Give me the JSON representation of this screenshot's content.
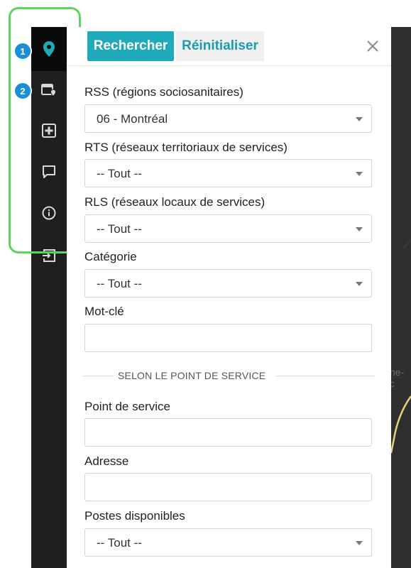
{
  "header": {
    "search_label": "Rechercher",
    "reset_label": "Réinitialiser",
    "close_icon": "close-icon"
  },
  "sidebar": {
    "items": [
      {
        "icon": "map-pin-icon",
        "badge": "1"
      },
      {
        "icon": "calendar-location-icon",
        "badge": "2"
      },
      {
        "icon": "plus-square-icon"
      },
      {
        "icon": "chat-bubble-icon"
      },
      {
        "icon": "info-circle-icon"
      },
      {
        "icon": "logout-icon"
      }
    ]
  },
  "form": {
    "rss": {
      "label": "RSS (régions sociosanitaires)",
      "value": "06 - Montréal"
    },
    "rts": {
      "label": "RTS (réseaux territoriaux de services)",
      "value": "-- Tout --"
    },
    "rls": {
      "label": "RLS (réseaux locaux de services)",
      "value": "-- Tout --"
    },
    "categorie": {
      "label": "Catégorie",
      "value": "-- Tout --"
    },
    "motcle": {
      "label": "Mot-clé",
      "value": ""
    },
    "section_title": "SELON LE POINT DE SERVICE",
    "point_service": {
      "label": "Point de service",
      "value": ""
    },
    "adresse": {
      "label": "Adresse",
      "value": ""
    },
    "postes": {
      "label": "Postes disponibles",
      "value": "-- Tout --"
    }
  },
  "map": {
    "label_fragment": "ne-\nc"
  },
  "colors": {
    "accent": "#1eaab8",
    "highlight": "#5fd35f",
    "badge": "#1a8fd8",
    "sidebar": "#1f1f1f"
  }
}
